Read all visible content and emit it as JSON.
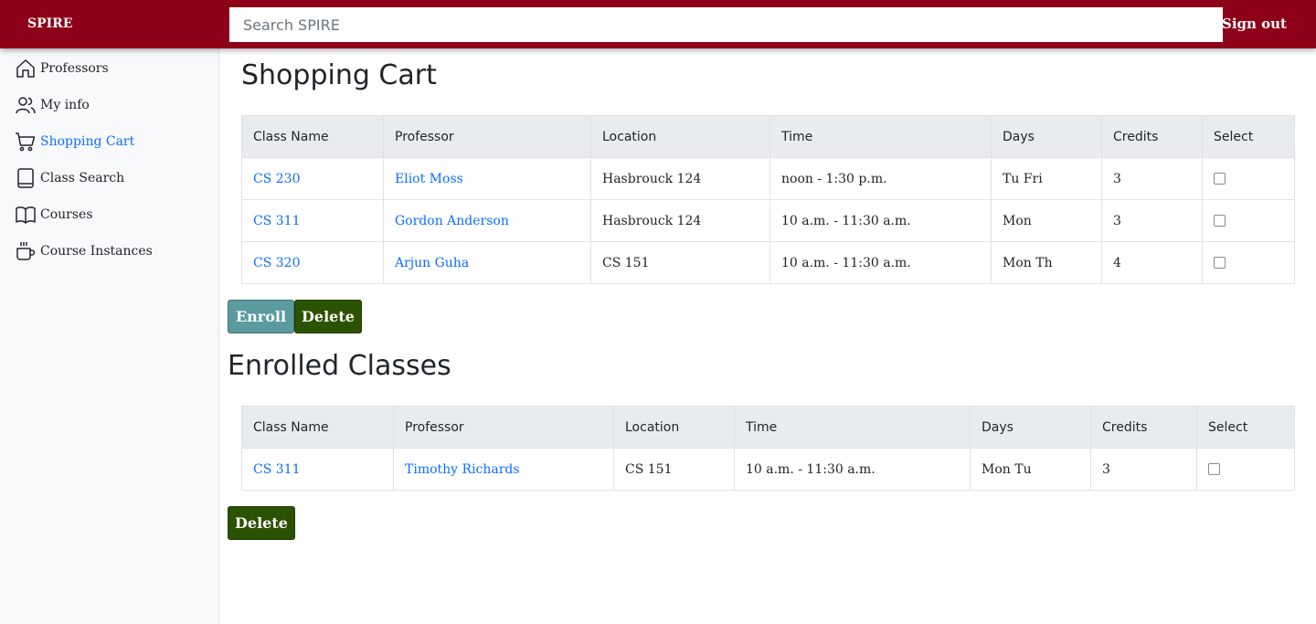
{
  "header": {
    "brand": "SPIRE",
    "search_placeholder": "Search SPIRE",
    "signout": "Sign out"
  },
  "sidebar": {
    "items": [
      {
        "label": "Professors",
        "icon": "house-icon",
        "active": false
      },
      {
        "label": "My info",
        "icon": "people-icon",
        "active": false
      },
      {
        "label": "Shopping Cart",
        "icon": "cart-icon",
        "active": true
      },
      {
        "label": "Class Search",
        "icon": "book-icon",
        "active": false
      },
      {
        "label": "Courses",
        "icon": "open-book-icon",
        "active": false
      },
      {
        "label": "Course Instances",
        "icon": "cup-icon",
        "active": false
      }
    ]
  },
  "cart": {
    "title": "Shopping Cart",
    "headers": [
      "Class Name",
      "Professor",
      "Location",
      "Time",
      "Days",
      "Credits",
      "Select"
    ],
    "rows": [
      {
        "class": "CS 230",
        "prof": "Eliot Moss",
        "location": "Hasbrouck 124",
        "time": "noon - 1:30 p.m.",
        "days": "Tu Fri",
        "credits": "3"
      },
      {
        "class": "CS 311",
        "prof": "Gordon Anderson",
        "location": "Hasbrouck 124",
        "time": "10 a.m. - 11:30 a.m.",
        "days": "Mon",
        "credits": "3"
      },
      {
        "class": "CS 320",
        "prof": "Arjun Guha",
        "location": "CS 151",
        "time": "10 a.m. - 11:30 a.m.",
        "days": "Mon Th",
        "credits": "4"
      }
    ],
    "enroll_label": "Enroll",
    "delete_label": "Delete"
  },
  "enrolled": {
    "title": "Enrolled Classes",
    "headers": [
      "Class Name",
      "Professor",
      "Location",
      "Time",
      "Days",
      "Credits",
      "Select"
    ],
    "rows": [
      {
        "class": "CS 311",
        "prof": "Timothy Richards",
        "location": "CS 151",
        "time": "10 a.m. - 11:30 a.m.",
        "days": "Mon Tu",
        "credits": "3"
      }
    ],
    "delete_label": "Delete"
  },
  "colors": {
    "header_bg": "#8d0018",
    "link": "#0d6efd",
    "enroll_button": "#5b9a9e",
    "delete_button": "#2b5200"
  }
}
